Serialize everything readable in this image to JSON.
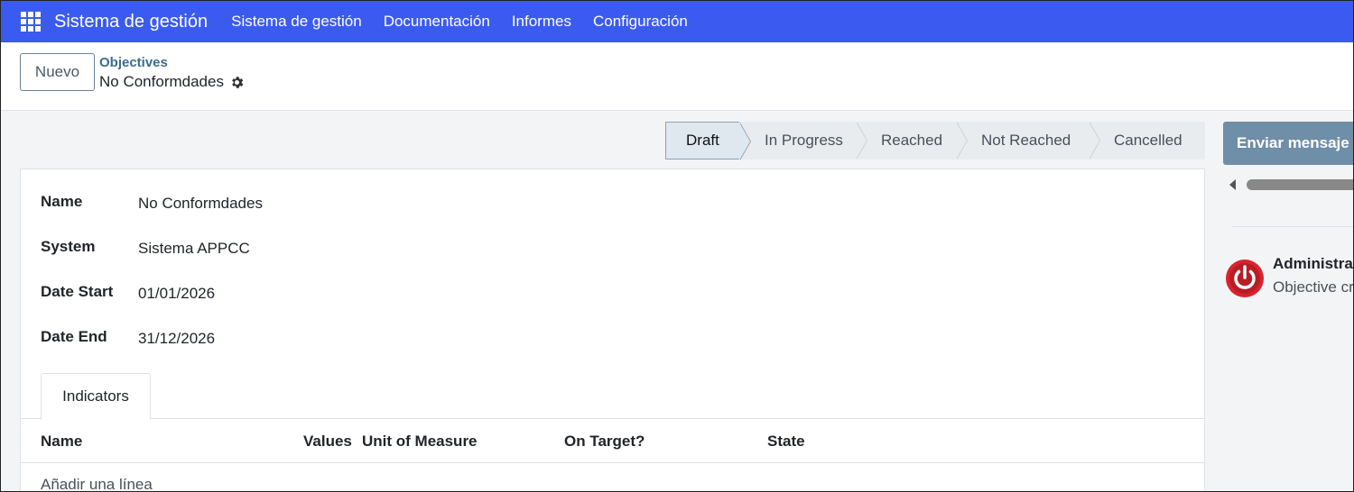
{
  "navbar": {
    "app_name": "Sistema de gestión",
    "menu": [
      "Sistema de gestión",
      "Documentación",
      "Informes",
      "Configuración"
    ],
    "background": "#3b5bf0"
  },
  "control_panel": {
    "new_button": "Nuevo",
    "breadcrumb": "Objectives",
    "record_title": "No Conformdades"
  },
  "statusbar": {
    "stages": [
      "Draft",
      "In Progress",
      "Reached",
      "Not Reached",
      "Cancelled"
    ],
    "active": "Draft"
  },
  "form": {
    "fields": [
      {
        "label": "Name",
        "value": "No Conformdades"
      },
      {
        "label": "System",
        "value": "Sistema APPCC"
      },
      {
        "label": "Date Start",
        "value": "01/01/2026"
      },
      {
        "label": "Date End",
        "value": "31/12/2026"
      }
    ],
    "tab": "Indicators",
    "columns": [
      "Name",
      "Values",
      "Unit of Measure",
      "On Target?",
      "State"
    ],
    "add_line": "Añadir una línea"
  },
  "chatter": {
    "send_button": "Enviar mensaje",
    "author": "Administrador",
    "message": "Objective created",
    "avatar_color": "#d9232e"
  }
}
